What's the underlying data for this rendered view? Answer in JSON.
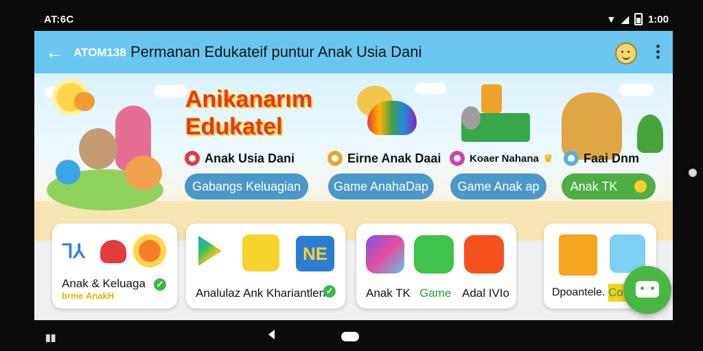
{
  "status": {
    "carrier": "AT:6C",
    "time": "1:00"
  },
  "appbar": {
    "brand": "ATOM138",
    "title": "Permanan Edukateif puntur Anak Usia Dani"
  },
  "banner": {
    "headline_line1": "Anikanarım",
    "headline_line2": "Edukatel",
    "categories": [
      {
        "label": "Anak Usia Dani",
        "button": "Gabangs Keluagian",
        "color": "#e23b48"
      },
      {
        "label": "Eirne Anak Daai",
        "button": "Game AnahaDap",
        "color": "#f1a623"
      },
      {
        "label": "Koaer Nahana",
        "button": "Game Anak ap",
        "color": "#cf3fb5"
      },
      {
        "label": "Faai Dnm",
        "button": "Anak TK",
        "color": "#5aaee0"
      }
    ]
  },
  "cards": [
    {
      "label": "Anak & Keluaga",
      "sublabel": "brme AnakH"
    },
    {
      "label": "Analulaz Ank Khariantlen"
    },
    {
      "label_a": "Anak TK",
      "label_b": "Game",
      "label_c": "Adal IVIo"
    },
    {
      "label": "Dpoantele.",
      "label_b": "Co"
    }
  ],
  "colors": {
    "appbar": "#69c6f0",
    "pill_blue": "#4a98c8",
    "pill_green": "#4eae43",
    "fab": "#4bb543"
  }
}
